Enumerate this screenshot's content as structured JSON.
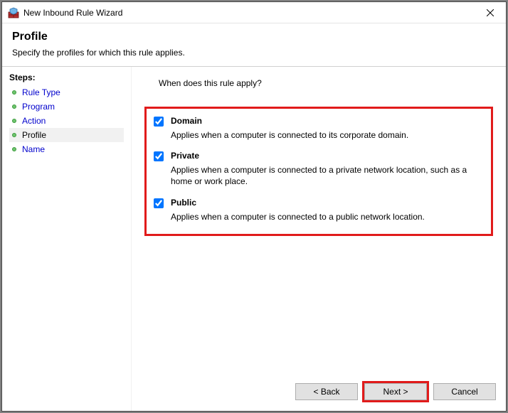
{
  "window": {
    "title": "New Inbound Rule Wizard"
  },
  "header": {
    "title": "Profile",
    "subtitle": "Specify the profiles for which this rule applies."
  },
  "sidebar": {
    "label": "Steps:",
    "items": [
      {
        "label": "Rule Type",
        "current": false
      },
      {
        "label": "Program",
        "current": false
      },
      {
        "label": "Action",
        "current": false
      },
      {
        "label": "Profile",
        "current": true
      },
      {
        "label": "Name",
        "current": false
      }
    ]
  },
  "content": {
    "question": "When does this rule apply?",
    "profiles": [
      {
        "name": "Domain",
        "checked": true,
        "desc": "Applies when a computer is connected to its corporate domain."
      },
      {
        "name": "Private",
        "checked": true,
        "desc": "Applies when a computer is connected to a private network location, such as a home or work place."
      },
      {
        "name": "Public",
        "checked": true,
        "desc": "Applies when a computer is connected to a public network location."
      }
    ]
  },
  "buttons": {
    "back": "< Back",
    "next": "Next >",
    "cancel": "Cancel"
  }
}
